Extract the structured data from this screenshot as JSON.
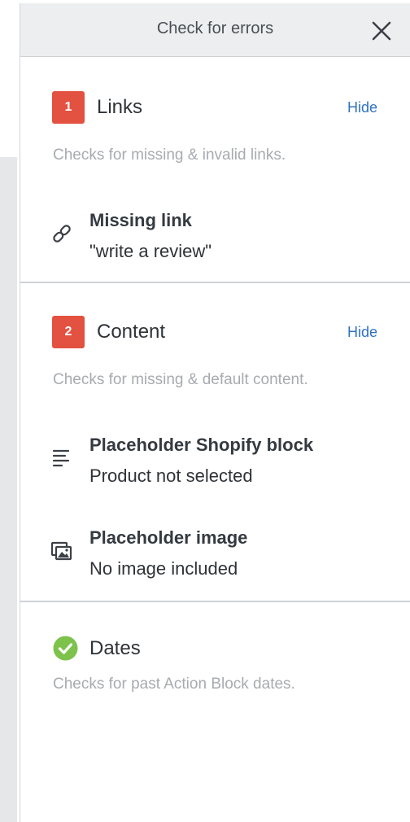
{
  "header": {
    "title": "Check for errors"
  },
  "sections": {
    "links": {
      "badge": "1",
      "title": "Links",
      "hide_label": "Hide",
      "description": "Checks for missing & invalid links.",
      "items": [
        {
          "icon": "link-icon",
          "title": "Missing link",
          "subtitle": "\"write a review\""
        }
      ]
    },
    "content": {
      "badge": "2",
      "title": "Content",
      "hide_label": "Hide",
      "description": "Checks for missing & default content.",
      "items": [
        {
          "icon": "text-lines-icon",
          "title": "Placeholder Shopify block",
          "subtitle": "Product not selected"
        },
        {
          "icon": "image-icon",
          "title": "Placeholder image",
          "subtitle": "No image included"
        }
      ]
    },
    "dates": {
      "icon": "check-circle-icon",
      "title": "Dates",
      "description": "Checks for past Action Block dates."
    }
  },
  "colors": {
    "badge_red": "#e35140",
    "link_blue": "#2f72c4",
    "success_green": "#7cc24b",
    "header_bg": "#eceef0"
  }
}
